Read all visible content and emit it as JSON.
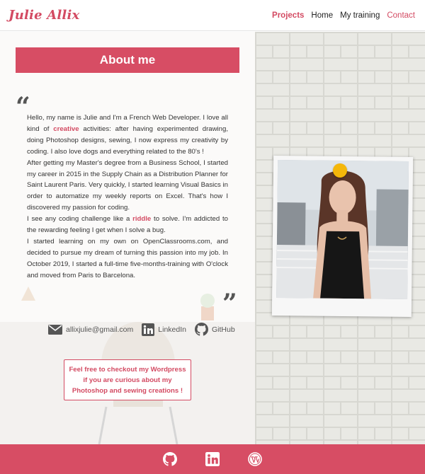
{
  "header": {
    "logo": "Julie Allix",
    "nav": [
      {
        "label": "Projects"
      },
      {
        "label": "Home"
      },
      {
        "label": "My training"
      },
      {
        "label": "Contact"
      }
    ]
  },
  "about": {
    "title": "About me",
    "paragraphs": [
      {
        "before": "Hello, my name is Julie and I'm a French Web Developer. I love all kind of ",
        "highlight": "creative",
        "after": " activities: after having experimented drawing, doing Photoshop designs, sewing, I now express my creativity by coding. I also love dogs and everything related to the 80's !"
      },
      {
        "text": "After getting my Master's degree from a Business School, I started my career in 2015 in the Supply Chain as a Distribution Planner for Saint Laurent Paris. Very quickly, I started learning Visual Basics in order to automatize my weekly reports on Excel. That's how I discovered my passion for coding."
      },
      {
        "before": "I see any coding challenge like a ",
        "highlight": "riddle",
        "after": " to solve. I'm addicted to the rewarding feeling I get when I solve a bug."
      },
      {
        "text": "I started learning on my own on OpenClassrooms.com, and decided to pursue my dream of turning this passion into my job. In October 2019, I started a full-time five-months-training with O'clock and moved from Paris to Barcelona."
      }
    ]
  },
  "contacts": {
    "email": "allixjulie@gmail.com",
    "linkedin": "LinkedIn",
    "github": "GitHub"
  },
  "wordpress_box": {
    "text": "Feel free to checkout my Wordpress if you are curious about my Photoshop and sewing creations !"
  },
  "footer": {
    "icons": [
      "github-icon",
      "linkedin-icon",
      "wordpress-icon"
    ]
  },
  "colors": {
    "accent": "#d74d64",
    "pin": "#f5b70a"
  }
}
